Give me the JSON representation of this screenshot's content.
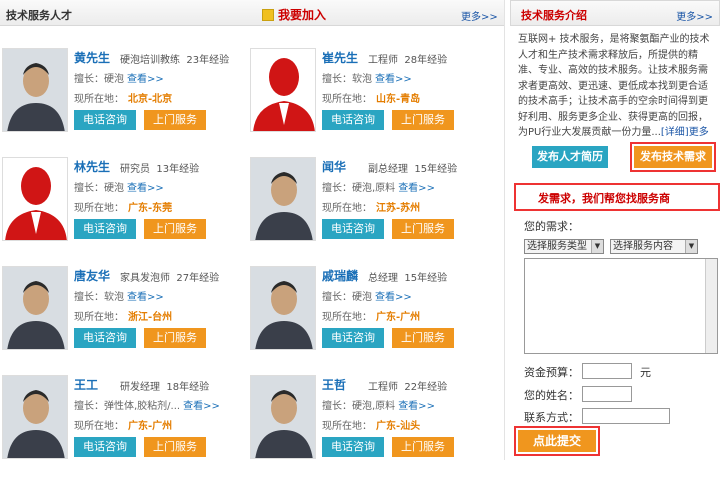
{
  "left_header": {
    "title": "技术服务人才",
    "join": "我要加入",
    "more": "更多>>"
  },
  "people": [
    {
      "name": "黄先生",
      "title": "硬泡培训教练",
      "years": "23年经验",
      "skill_label": "擅长：",
      "skill": "硬泡",
      "more": "查看>>",
      "loc_label": "现所在地：",
      "loc": "北京-北京",
      "btn_call": "电话咨询",
      "btn_visit": "上门服务",
      "photo": "man-photo"
    },
    {
      "name": "崔先生",
      "title": "工程师",
      "years": "28年经验",
      "skill_label": "擅长：",
      "skill": "软泡",
      "more": "查看>>",
      "loc_label": "现所在地：",
      "loc": "山东-青岛",
      "btn_call": "电话咨询",
      "btn_visit": "上门服务",
      "photo": "default-avatar"
    },
    {
      "name": "林先生",
      "title": "研究员",
      "years": "13年经验",
      "skill_label": "擅长：",
      "skill": "硬泡",
      "more": "查看>>",
      "loc_label": "现所在地：",
      "loc": "广东-东莞",
      "btn_call": "电话咨询",
      "btn_visit": "上门服务",
      "photo": "default-avatar"
    },
    {
      "name": "闻华",
      "title": "副总经理",
      "years": "15年经验",
      "skill_label": "擅长：",
      "skill": "硬泡,原料",
      "more": "查看>>",
      "loc_label": "现所在地：",
      "loc": "江苏-苏州",
      "btn_call": "电话咨询",
      "btn_visit": "上门服务",
      "photo": "man-photo"
    },
    {
      "name": "唐友华",
      "title": "家具发泡师",
      "years": "27年经验",
      "skill_label": "擅长：",
      "skill": "软泡",
      "more": "查看>>",
      "loc_label": "现所在地：",
      "loc": "浙江-台州",
      "btn_call": "电话咨询",
      "btn_visit": "上门服务",
      "photo": "man-photo"
    },
    {
      "name": "戚瑞麟",
      "title": "总经理",
      "years": "15年经验",
      "skill_label": "擅长：",
      "skill": "硬泡",
      "more": "查看>>",
      "loc_label": "现所在地：",
      "loc": "广东-广州",
      "btn_call": "电话咨询",
      "btn_visit": "上门服务",
      "photo": "man-photo"
    },
    {
      "name": "王工",
      "title": "研发经理",
      "years": "18年经验",
      "skill_label": "擅长：",
      "skill": "弹性体,胶粘剂/...",
      "more": "查看>>",
      "loc_label": "现所在地：",
      "loc": "广东-广州",
      "btn_call": "电话咨询",
      "btn_visit": "上门服务",
      "photo": "man-photo"
    },
    {
      "name": "王哲",
      "title": "工程师",
      "years": "22年经验",
      "skill_label": "擅长：",
      "skill": "硬泡,原料",
      "more": "查看>>",
      "loc_label": "现所在地：",
      "loc": "广东-汕头",
      "btn_call": "电话咨询",
      "btn_visit": "上门服务",
      "photo": "man-photo"
    }
  ],
  "right": {
    "intro_title": "技术服务介绍",
    "more": "更多>>",
    "intro_text": "互联网+ 技术服务，是将聚氨酯产业的技术人才和生产技术需求释放后，所提供的精准、专业、高效的技术服务。让技术服务需求者更高效、更迅速、更低成本找到更合适的技术高手；让技术高手的空余时间得到更好利用、服务更多企业、获得更高的回报，为PU行业大发展贡献一份力量...",
    "intro_link": "[详细]更多>>",
    "btn_resume": "发布人才简历",
    "btn_demand": "发布技术需求",
    "form_title": "发需求，我们帮您找服务商",
    "need_label": "您的需求：",
    "select1": "选择服务类型",
    "select2": "选择服务内容",
    "budget_label": "资金预算：",
    "budget_unit": "元",
    "name_label": "您的姓名：",
    "contact_label": "联系方式：",
    "submit": "点此提交"
  },
  "colors": {
    "teal": "#2aa5c2",
    "orange": "#f0961e",
    "red": "#cc0000",
    "link": "#1a6fb7"
  }
}
